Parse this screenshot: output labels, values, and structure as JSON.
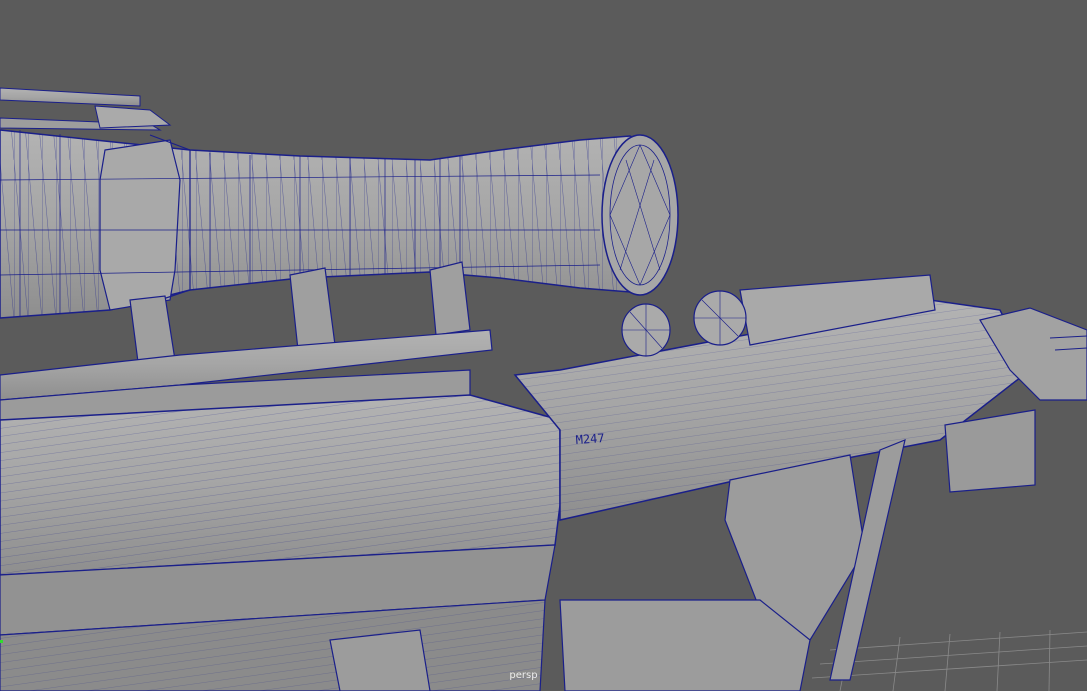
{
  "viewport": {
    "camera_label": "persp",
    "background_color": "#5b5b5b",
    "mesh_fill_color": "#a3a3a3",
    "wire_color": "#1a1f8a",
    "grid_color": "#8a8a8a"
  },
  "model": {
    "engraving_text": "M247"
  }
}
